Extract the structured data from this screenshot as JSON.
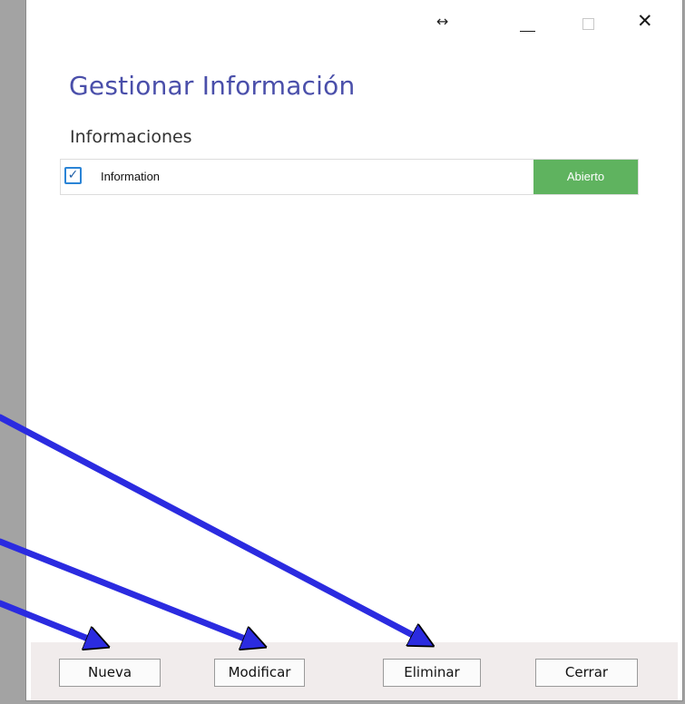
{
  "window": {
    "controls": {
      "resize_glyph": "↔",
      "close_glyph": "✕"
    }
  },
  "main": {
    "title": "Gestionar Información",
    "list_label": "Informaciones",
    "items": [
      {
        "checked": true,
        "check_glyph": "✓",
        "label": "Information",
        "status": "Abierto",
        "status_color": "#5fb35f"
      }
    ]
  },
  "footer": {
    "nueva_label": "Nueva",
    "modificar_label": "Modificar",
    "eliminar_label": "Eliminar",
    "cerrar_label": "Cerrar"
  },
  "colors": {
    "title": "#4a4faa",
    "annotation_arrow": "#2b2be0",
    "footer_bg": "#f1ecec"
  }
}
